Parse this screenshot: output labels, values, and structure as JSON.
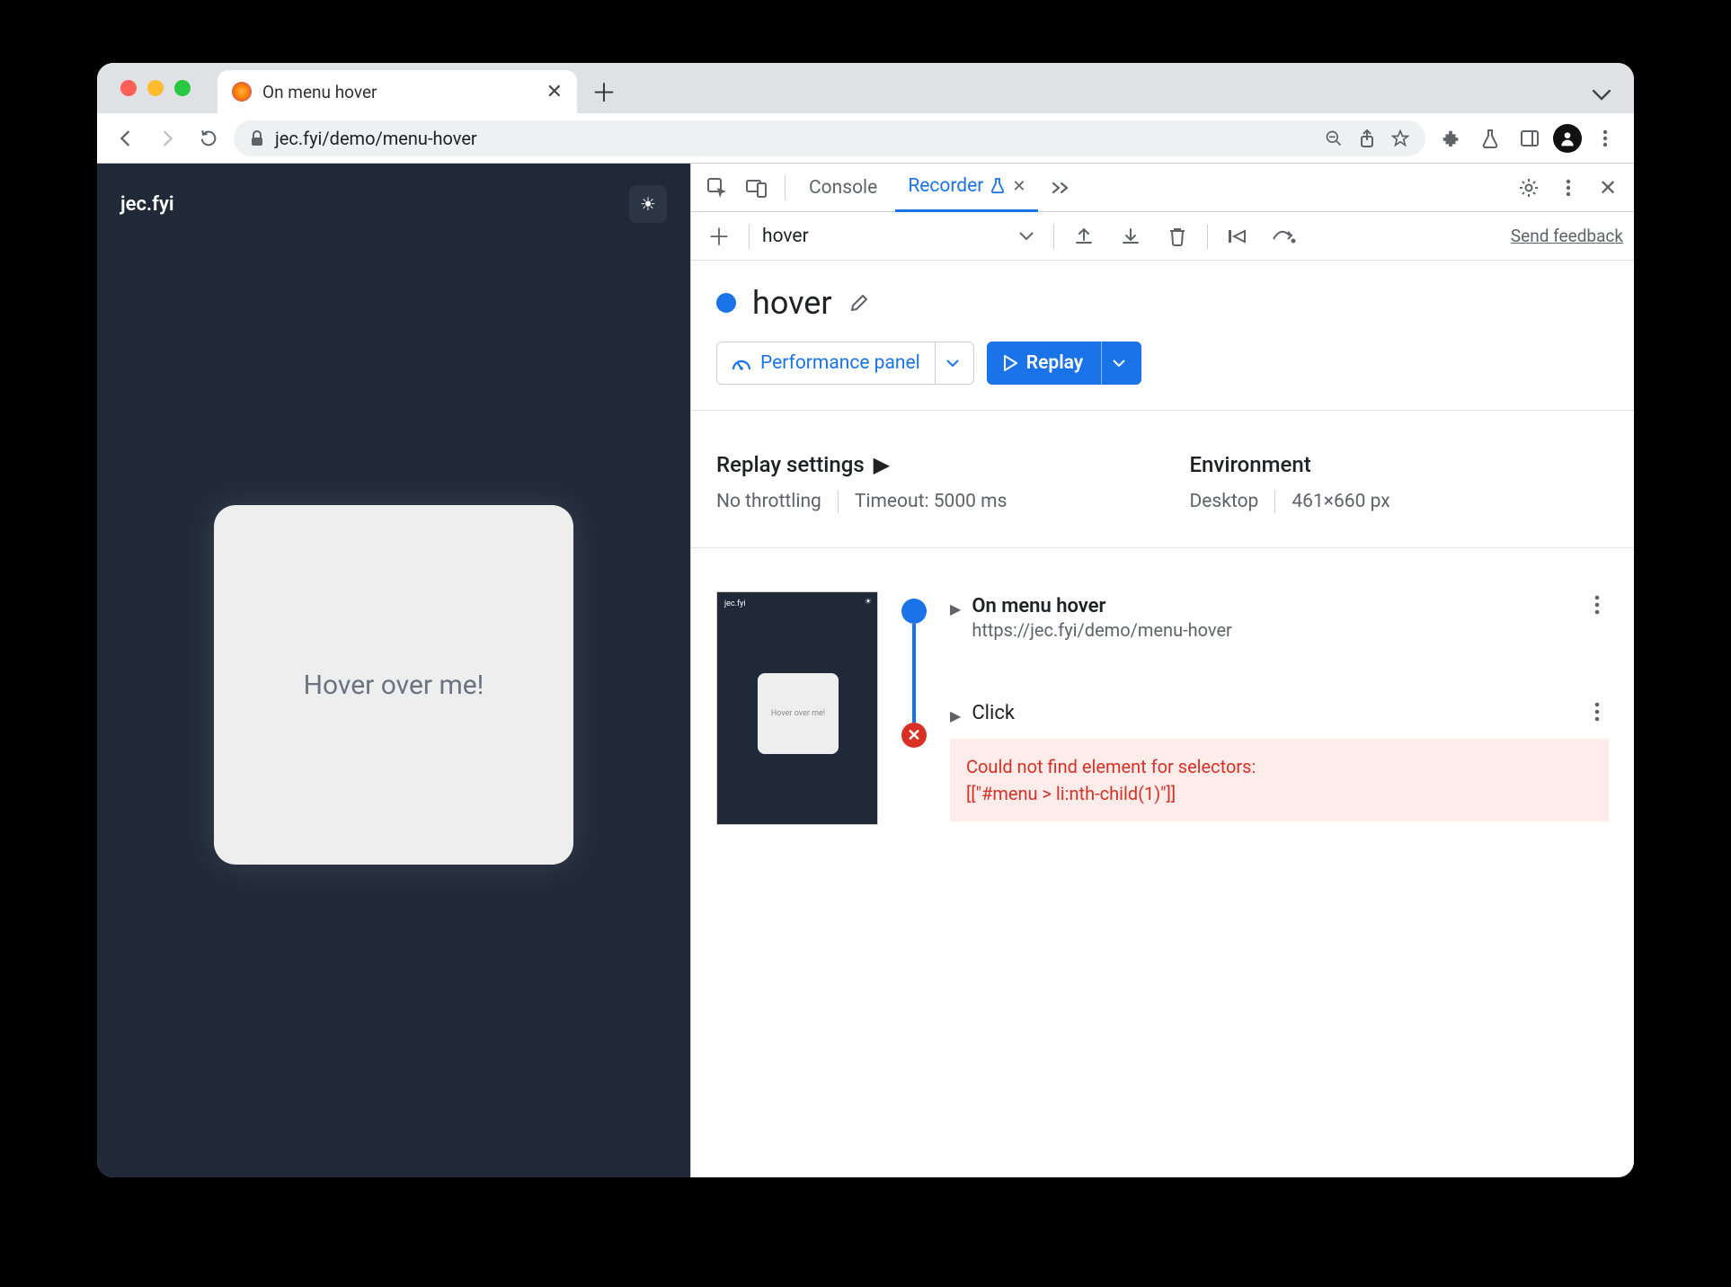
{
  "browser": {
    "tab_title": "On menu hover",
    "url_display": "jec.fyi/demo/menu-hover"
  },
  "page": {
    "brand": "jec.fyi",
    "hover_text": "Hover over me!"
  },
  "devtools": {
    "tabs": {
      "console": "Console",
      "recorder": "Recorder"
    },
    "toolbar": {
      "recording_name": "hover",
      "send_feedback": "Send feedback"
    },
    "title": "hover",
    "perf_button": "Performance panel",
    "replay_button": "Replay",
    "settings": {
      "replay_title": "Replay settings",
      "throttling": "No throttling",
      "timeout": "Timeout: 5000 ms",
      "env_title": "Environment",
      "env_device": "Desktop",
      "env_size": "461×660 px"
    },
    "steps": {
      "step1_title": "On menu hover",
      "step1_url": "https://jec.fyi/demo/menu-hover",
      "step2_title": "Click",
      "error_line1": "Could not find element for selectors:",
      "error_line2": "[[\"#menu > li:nth-child(1)\"]]"
    },
    "mini_text": "Hover over me!"
  }
}
